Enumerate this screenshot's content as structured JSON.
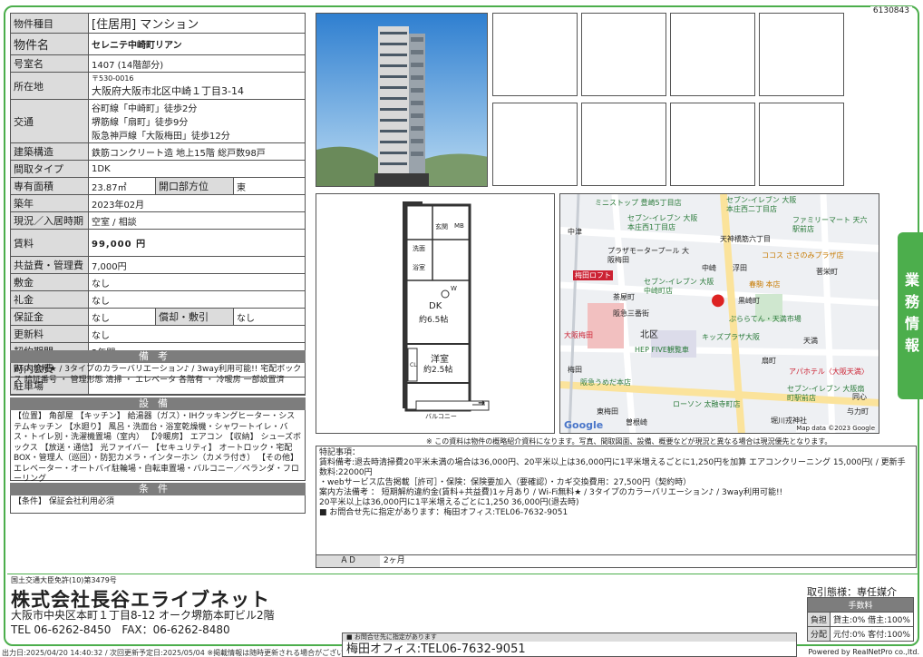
{
  "doc_id": "6130843",
  "property": {
    "type_label": "物件種目",
    "type_value": "[住居用] マンション",
    "name_label": "物件名",
    "name_value": "セレニテ中崎町リアン",
    "room_label": "号室名",
    "room_value": "1407 (14階部分)",
    "addr_label": "所在地",
    "zip": "〒530-0016",
    "addr_value": "大阪府大阪市北区中崎１丁目3-14",
    "traffic_label": "交通",
    "traffic": [
      "谷町線「中崎町」徒歩2分",
      "堺筋線「扇町」徒歩9分",
      "阪急神戸線「大阪梅田」徒歩12分"
    ],
    "structure_label": "建築構造",
    "structure_value": "鉄筋コンクリート造 地上15階 総戸数98戸",
    "layout_label": "間取タイプ",
    "layout_value": "1DK",
    "area_label": "専有面積",
    "area_value": "23.87㎡",
    "dir_label": "開口部方位",
    "dir_value": "東",
    "built_label": "築年",
    "built_value": "2023年02月",
    "status_label": "現況／入居時期",
    "status_value": "空室 / 相談",
    "rent_label": "賃料",
    "rent_value": "99,000 円",
    "fee_label": "共益費・管理費",
    "fee_value": "7,000円",
    "deposit_label": "敷金",
    "deposit_value": "なし",
    "keymoney_label": "礼金",
    "keymoney_value": "なし",
    "guarantee_label": "保証金",
    "guarantee_value": "なし",
    "amort_label": "償却・敷引",
    "amort_value": "なし",
    "renew_label": "更新料",
    "renew_value": "なし",
    "term_label": "契約期間",
    "term_value": "2年間",
    "community_label": "町内会費",
    "community_value": "",
    "parking_label": "駐車場",
    "parking_value": ""
  },
  "sections": {
    "remarks_title": "備考",
    "remarks_text": "Wi-Fi無料★ / 3タイプのカラーバリエーション♪ / 3way利用可能!! 宅配ボックス 暗証番号 ・ 管理形態 清掃 ・ エレベータ 各階有 ・ 冷暖房 一部設置済",
    "facilities_title": "設備",
    "facilities_text": "【位置】 角部屋 【キッチン】 給湯器（ガス）・IHクッキングヒーター・システムキッチン 【水廻り】 風呂・洗面台・浴室乾燥機・シャワートイレ・バス・トイレ別・洗濯機置場（室内） 【冷暖房】 エアコン 【収納】 シューズボックス 【放送・通信】 光ファイバー 【セキュリティ】 オートロック・宅配BOX・管理人（巡回）・防犯カメラ・インターホン（カメラ付き） 【その他】 エレベーター・オートバイ駐輪場・自転車置場・バルコニー／ベランダ・フローリング",
    "conditions_title": "条件",
    "conditions_text": "【条件】 保証会社利用必須"
  },
  "floorplan": {
    "entrance": "玄関",
    "mb": "MB",
    "wash": "洗面",
    "bath": "浴室",
    "dk": "DK",
    "dk_size": "約6.5帖",
    "room": "洋室",
    "room_size": "約2.5帖",
    "balcony": "バルコニー",
    "cl": "CL",
    "w": "W"
  },
  "map": {
    "labels": [
      "ミニストップ 豊崎5丁目店",
      "セブン-イレブン 大阪 本庄西二丁目店",
      "セブン-イレブン 大阪本庄西1丁目店",
      "ファミリーマート 天六駅前店",
      "天神橋筋六丁目",
      "中津",
      "プラザモータープール 大阪梅田",
      "ココス ささのみプラザ店",
      "中崎",
      "浮田",
      "菅栄町",
      "梅田ロフト",
      "セブン-イレブン 大阪中崎町店",
      "春駒 本店",
      "茶屋町",
      "黒崎町",
      "阪急三番街",
      "北区",
      "ぷららてん・天満市場",
      "大阪梅田",
      "キッズプラザ大阪",
      "HEP FIVE観覧車",
      "天満",
      "阪急うめだ本店",
      "扇町",
      "アパホテル〈大阪天満〉",
      "梅田",
      "セブン-イレブン 大阪扇町駅前店",
      "ローソン 太融寺町店",
      "同心",
      "東梅田",
      "曽根崎",
      "堀川戎神社",
      "与力町"
    ],
    "footer": "Map data ©2023 Google",
    "brand": "Google"
  },
  "note_line": "※ この資料は物件の概略紹介資料になります。写真、間取図面、設備、概要などが現況と異なる場合は現況優先となります。",
  "special": {
    "title": "特記事項：",
    "lines": [
      "賃料備考:退去時清掃費20平米未満の場合は36,000円、20平米以上は36,000円に1平米増えるごとに1,250円を加算 エアコンクリーニング 15,000円( / 更新手数料:22000円",
      "・webサービス広告掲載［許可］・保険：保険要加入（要確認）・カギ交換費用：27,500円（契約時）",
      "案内方法備考 ： 短期解約違約金(賃料+共益費)1ヶ月あり / Wi-Fi無料★ / 3タイプのカラーバリエーション♪ / 3way利用可能!!",
      "20平米以上は36,000円に1平米増えるごとに1,250 36,000円(退去時)",
      "■ お問合せ先に指定があります：梅田オフィス:TEL06-7632-9051"
    ]
  },
  "ad": {
    "label": "ＡＤ",
    "value": "2ヶ月"
  },
  "side_tab": "業務情報",
  "company": {
    "license": "国土交通大臣免許(10)第3479号",
    "name": "株式会社長谷エライブネット",
    "address": "大阪市中央区本町１丁目8-12 オーク堺筋本町ビル2階",
    "tel": "TEL 06-6262-8450　FAX：06-6262-8480"
  },
  "deal": {
    "type": "取引態様：専任媒介",
    "fee_header": "手数料",
    "rows": [
      {
        "k": "負担",
        "v": "貸主:0% 借主:100%"
      },
      {
        "k": "分配",
        "v": "元付:0% 客付:100%"
      }
    ]
  },
  "contact": {
    "header": "■ お問合せ先に指定があります",
    "value": "梅田オフィス:TEL06-7632-9051"
  },
  "bottom": "出力日:2025/04/20 14:40:32 / 次回更新予定日:2025/05/04 ※掲載情報は随時更新される場合がございます",
  "powered": "Powered by RealNetPro co.,ltd."
}
